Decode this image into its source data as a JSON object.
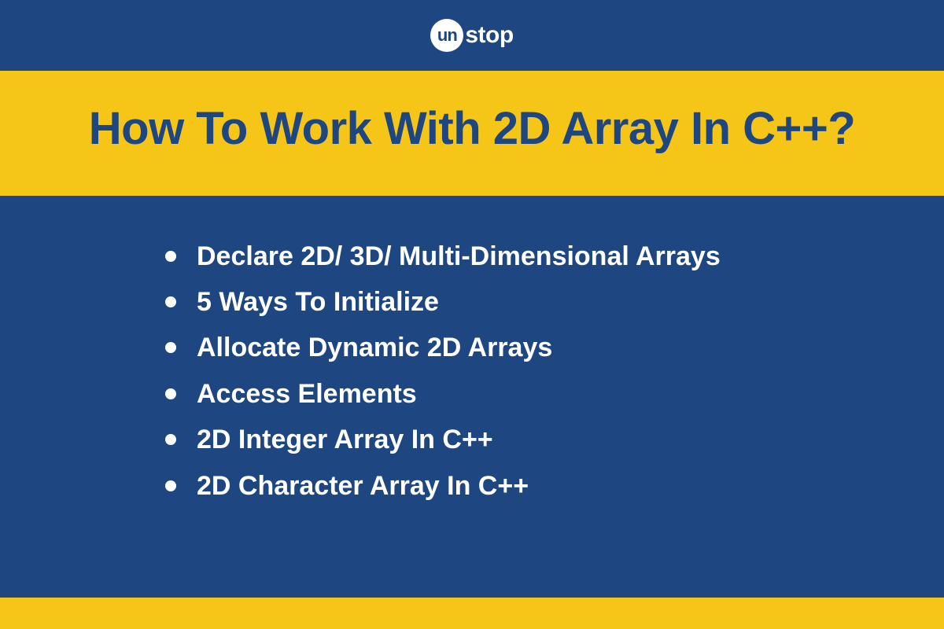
{
  "logo": {
    "prefix": "un",
    "suffix": "stop"
  },
  "title": "How To Work With 2D Array In C++?",
  "bullets": [
    "Declare 2D/ 3D/ Multi-Dimensional Arrays",
    "5 Ways To Initialize",
    "Allocate Dynamic 2D Arrays",
    "Access Elements",
    "2D Integer Array In C++",
    "2D Character Array In C++"
  ]
}
